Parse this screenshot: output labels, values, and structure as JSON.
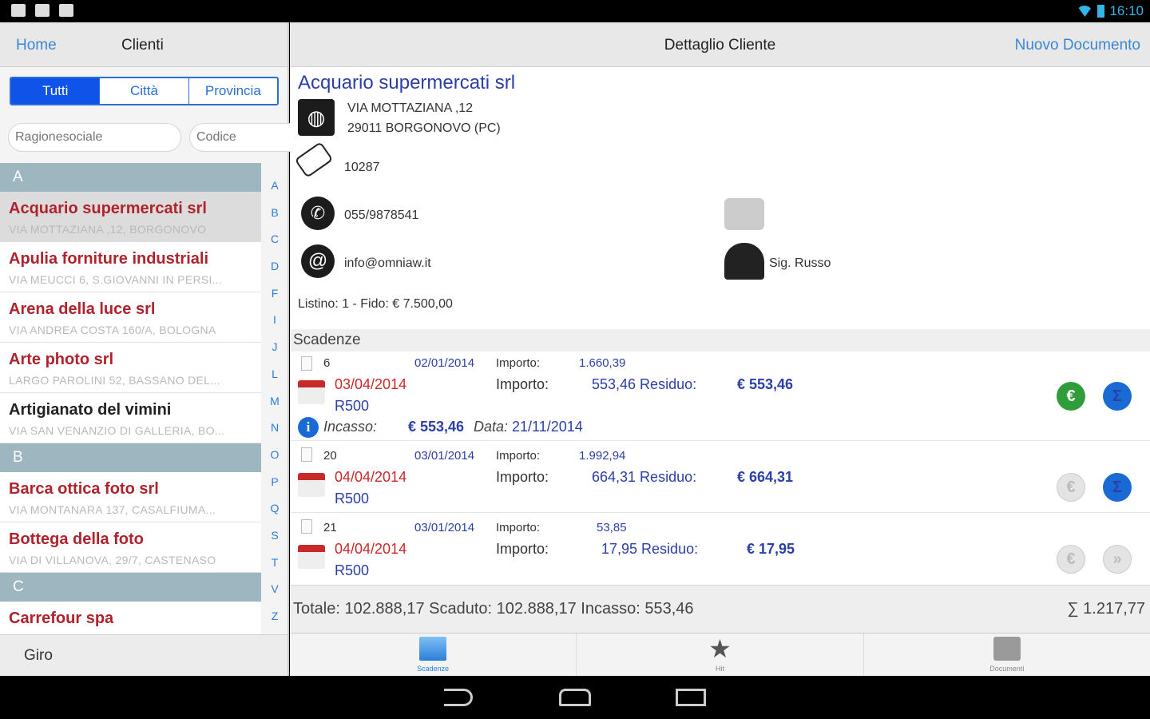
{
  "status": {
    "time": "16:10"
  },
  "left": {
    "home": "Home",
    "title": "Clienti",
    "segments": [
      "Tutti",
      "Città",
      "Provincia"
    ],
    "search_ragione": "Ragionesociale",
    "search_codice": "Codice",
    "sections": [
      {
        "letter": "A",
        "items": [
          {
            "name": "Acquario supermercati srl",
            "addr": "VIA MOTTAZIANA ,12, BORGONOVO"
          },
          {
            "name": "Apulia forniture industriali",
            "addr": "VIA MEUCCI 6, S.GIOVANNI IN PERSI..."
          },
          {
            "name": "Arena della luce srl",
            "addr": "VIA ANDREA COSTA 160/A, BOLOGNA"
          },
          {
            "name": "Arte photo srl",
            "addr": "LARGO PAROLINI 52, BASSANO DEL..."
          },
          {
            "name": "Artigianato del vimini",
            "addr": "VIA SAN VENANZIO DI GALLERIA, BO..."
          }
        ]
      },
      {
        "letter": "B",
        "items": [
          {
            "name": "Barca ottica foto srl",
            "addr": "VIA MONTANARA 137, CASALFIUMA..."
          },
          {
            "name": "Bottega della foto",
            "addr": "VIA DI VILLANOVA, 29/7, CASTENASO"
          }
        ]
      },
      {
        "letter": "C",
        "items": [
          {
            "name": "Carrefour spa",
            "addr": ""
          }
        ]
      }
    ],
    "index": [
      "A",
      "B",
      "C",
      "D",
      "F",
      "I",
      "J",
      "L",
      "M",
      "N",
      "O",
      "P",
      "Q",
      "S",
      "T",
      "V",
      "Z"
    ],
    "footer": "Giro"
  },
  "right": {
    "title": "Dettaglio Cliente",
    "new_doc": "Nuovo Documento",
    "customer": {
      "name": "Acquario supermercati srl",
      "addr1": "VIA MOTTAZIANA ,12",
      "addr2": "29011 BORGONOVO (PC)",
      "code": "10287",
      "phone": "055/9878541",
      "email": "info@omniaw.it",
      "contact": "Sig. Russo",
      "listino": "Listino: 1 - Fido: € 7.500,00"
    },
    "scadenze_label": "Scadenze",
    "dues": [
      {
        "num": "6",
        "date": "02/01/2014",
        "imp_label": "Importo:",
        "importo": "1.660,39",
        "due_date": "03/04/2014",
        "imp2_label": "Importo:",
        "importo2": "553,46 Residuo:",
        "residuo": "€ 553,46",
        "code": "R500",
        "incasso_label": "Incasso:",
        "incasso": "€ 553,46",
        "data_label": "Data:",
        "data": "21/11/2014"
      },
      {
        "num": "20",
        "date": "03/01/2014",
        "imp_label": "Importo:",
        "importo": "1.992,94",
        "due_date": "04/04/2014",
        "imp2_label": "Importo:",
        "importo2": "664,31 Residuo:",
        "residuo": "€ 664,31",
        "code": "R500"
      },
      {
        "num": "21",
        "date": "03/01/2014",
        "imp_label": "Importo:",
        "importo": "53,85",
        "due_date": "04/04/2014",
        "imp2_label": "Importo:",
        "importo2": "17,95 Residuo:",
        "residuo": "€ 17,95",
        "code": "R500"
      }
    ],
    "totals": "Totale: 102.888,17   Scaduto: 102.888,17   Incasso: 553,46",
    "sum": "∑ 1.217,77",
    "tabs": [
      "Scadenze",
      "Hit",
      "Documenti"
    ]
  }
}
